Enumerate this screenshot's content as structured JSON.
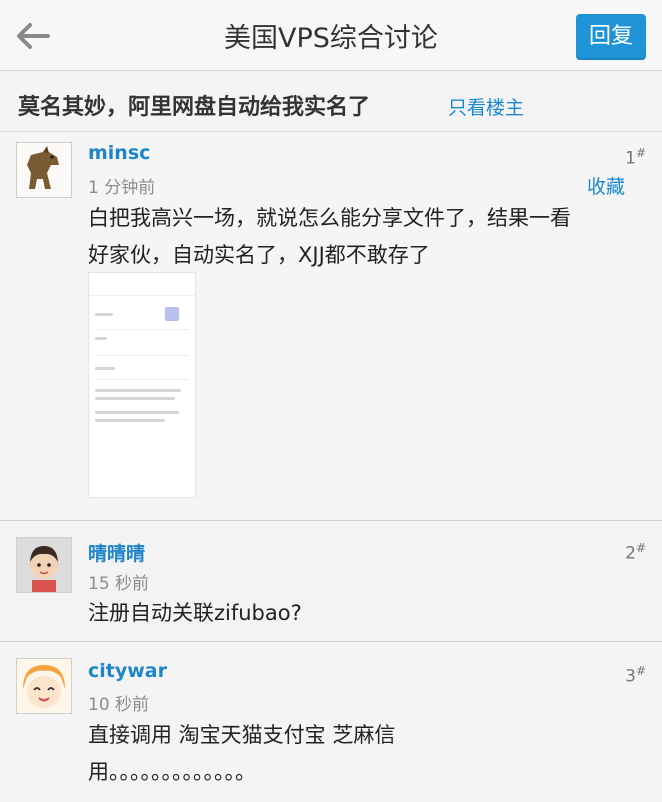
{
  "header": {
    "title": "美国VPS综合讨论",
    "reply_label": "回复"
  },
  "thread": {
    "title": "莫名其妙，阿里网盘自动给我实名了",
    "only_op_label": "只看楼主"
  },
  "posts": [
    {
      "username": "minsc",
      "time": "1 分钟前",
      "floor": "1",
      "floor_mark": "#",
      "fav_label": "收藏",
      "content_line1": "白把我高兴一场，就说怎么能分享文件了，结果一看",
      "content_line2": "好家伙，自动实名了，XJJ都不敢存了"
    },
    {
      "username": "晴晴晴",
      "time": "15 秒前",
      "floor": "2",
      "floor_mark": "#",
      "content_line1": "注册自动关联zifubao?"
    },
    {
      "username": "citywar",
      "time": "10 秒前",
      "floor": "3",
      "floor_mark": "#",
      "content_line1": "直接调用   淘宝天猫支付宝 芝麻信",
      "content_line2": "用。。。。。。。。。。。。。"
    }
  ],
  "icons": {
    "back": "back-arrow-icon"
  },
  "colors": {
    "accent": "#1e94d6",
    "link": "#1d85c9"
  }
}
